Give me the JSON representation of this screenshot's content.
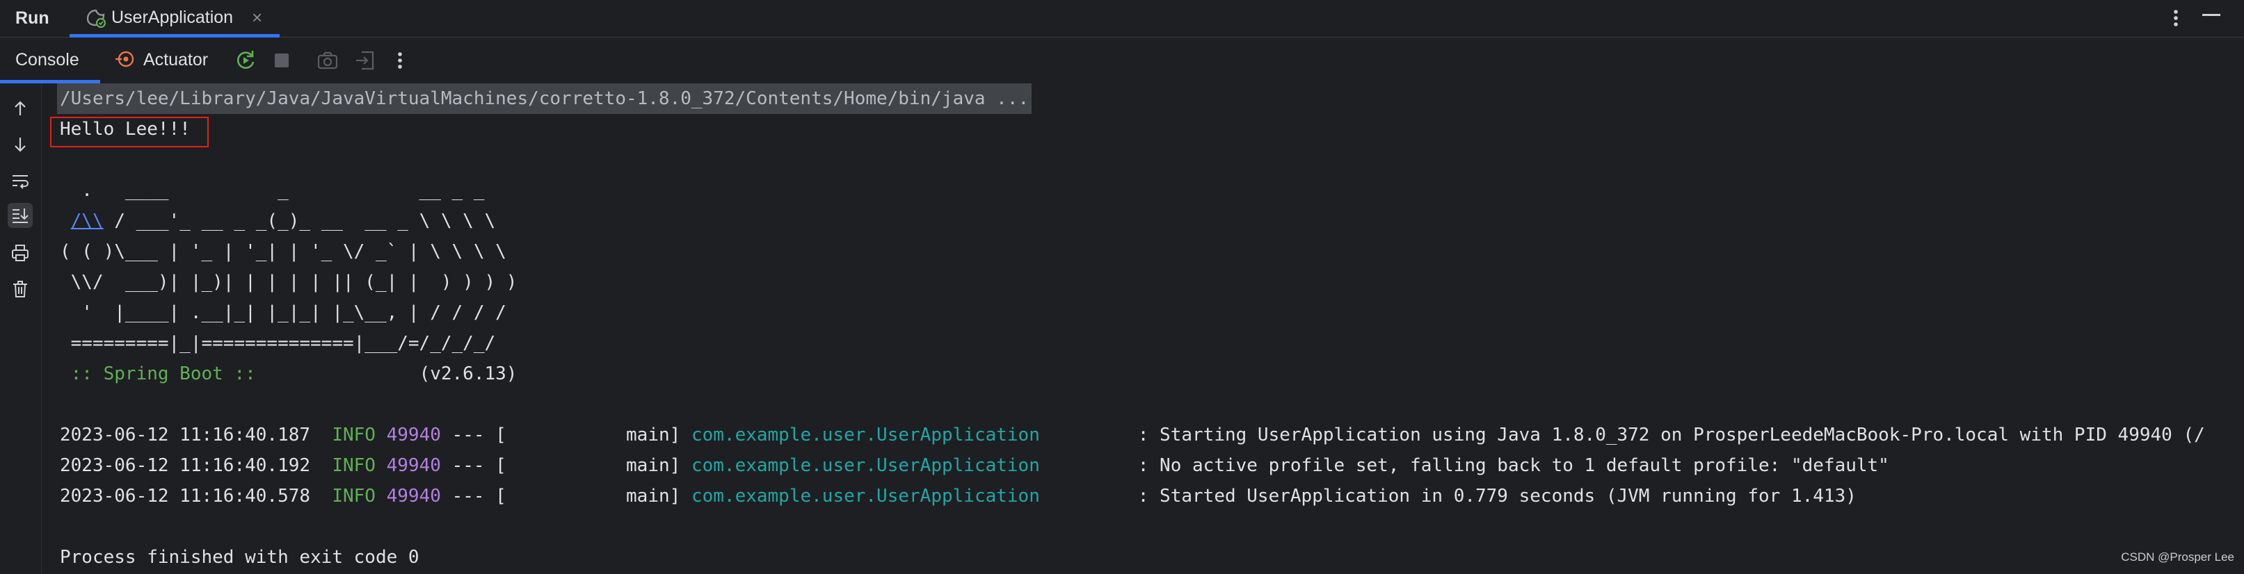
{
  "titlebar": {
    "run_label": "Run",
    "tab_label": "UserApplication",
    "tab_close": "×"
  },
  "toolbar": {
    "console_label": "Console",
    "actuator_label": "Actuator"
  },
  "console": {
    "command": "/Users/lee/Library/Java/JavaVirtualMachines/corretto-1.8.0_372/Contents/Home/bin/java ...",
    "hello": "Hello Lee!!!",
    "banner": [
      "  .   ____          _            __ _ _",
      " /\\\\ / ___'_ __ _ _(_)_ __  __ _ \\ \\ \\ \\",
      "( ( )\\___ | '_ | '_| | '_ \\/ _` | \\ \\ \\ \\",
      " \\\\/  ___)| |_)| | | | | || (_| |  ) ) ) )",
      "  '  |____| .__|_| |_|_| |_\\__, | / / / /",
      " =========|_|==============|___/=/_/_/_/"
    ],
    "banner_link": "/\\\\",
    "spring_boot_label": " :: Spring Boot :: ",
    "spring_boot_version": "              (v2.6.13)",
    "logs": [
      {
        "timestamp": "2023-06-12 11:16:40.187",
        "level": "INFO",
        "pid": "49940",
        "sep": "--- [",
        "thread": "           main]",
        "logger": "com.example.user.UserApplication",
        "message": ": Starting UserApplication using Java 1.8.0_372 on ProsperLeedeMacBook-Pro.local with PID 49940 (/"
      },
      {
        "timestamp": "2023-06-12 11:16:40.192",
        "level": "INFO",
        "pid": "49940",
        "sep": "--- [",
        "thread": "           main]",
        "logger": "com.example.user.UserApplication",
        "message": ": No active profile set, falling back to 1 default profile: \"default\""
      },
      {
        "timestamp": "2023-06-12 11:16:40.578",
        "level": "INFO",
        "pid": "49940",
        "sep": "--- [",
        "thread": "           main]",
        "logger": "com.example.user.UserApplication",
        "message": ": Started UserApplication in 0.779 seconds (JVM running for 1.413)"
      }
    ],
    "exit_message": "Process finished with exit code 0"
  },
  "watermark": "CSDN @Prosper Lee",
  "colors": {
    "accent": "#3574f0",
    "info_green": "#5fb155",
    "pid_purple": "#b180e0",
    "logger_teal": "#1fa7a8",
    "highlight_red": "#e0221b"
  }
}
